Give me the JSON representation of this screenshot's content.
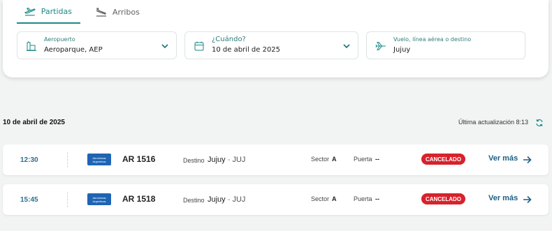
{
  "tabs": [
    {
      "label": "Partidas",
      "icon": "departure-plane-icon",
      "active": true
    },
    {
      "label": "Arribos",
      "icon": "arrival-plane-icon",
      "active": false
    }
  ],
  "filters": {
    "airport": {
      "label": "Aeropuerto",
      "value": "Aeroparque, AEP",
      "icon": "terminal-icon"
    },
    "date": {
      "label": "¿Cuándo?",
      "value": "10 de abril de 2025",
      "icon": "calendar-icon"
    },
    "search": {
      "label": "Vuelo, línea aérea o destino",
      "value": "Jujuy",
      "icon": "plane-icon"
    }
  },
  "results": {
    "date_heading": "10 de abril de 2025",
    "last_update": "Última actualización 8:13"
  },
  "colors": {
    "accent": "#1a8a86",
    "status_cancelled": "#d7222c",
    "link": "#1a5f86"
  },
  "flights": [
    {
      "time": "12:30",
      "airline_logo": "Aerolíneas Argentinas",
      "flight_number": "AR 1516",
      "destination_label": "Destino",
      "destination_city": "Jujuy",
      "destination_sep": " - ",
      "destination_code": "JUJ",
      "sector_label": "Sector",
      "sector": "A",
      "gate_label": "Puerta",
      "gate": "--",
      "status": "CANCELADO",
      "more_label": "Ver más"
    },
    {
      "time": "15:45",
      "airline_logo": "Aerolíneas Argentinas",
      "flight_number": "AR 1518",
      "destination_label": "Destino",
      "destination_city": "Jujuy",
      "destination_sep": " - ",
      "destination_code": "JUJ",
      "sector_label": "Sector",
      "sector": "A",
      "gate_label": "Puerta",
      "gate": "--",
      "status": "CANCELADO",
      "more_label": "Ver más"
    }
  ]
}
